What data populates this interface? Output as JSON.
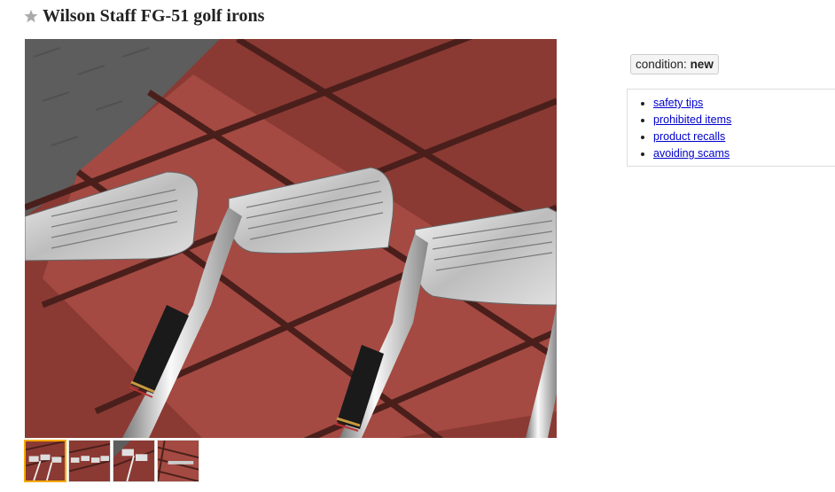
{
  "post": {
    "title": "Wilson Staff FG-51 golf irons",
    "favorite_icon": "star-icon",
    "icon_color": "#aaaaaa"
  },
  "gallery": {
    "main_image_alt": "golf iron heads on red wooden bench",
    "thumbnails": [
      {
        "selected": true
      },
      {
        "selected": false
      },
      {
        "selected": false
      },
      {
        "selected": false
      }
    ],
    "selected_color": "#f7a800"
  },
  "attributes": {
    "condition_label": "condition:",
    "condition_value": "new"
  },
  "safety_links": {
    "items": [
      "safety tips",
      "prohibited items",
      "product recalls",
      "avoiding scams"
    ],
    "link_color": "#0000cc"
  }
}
